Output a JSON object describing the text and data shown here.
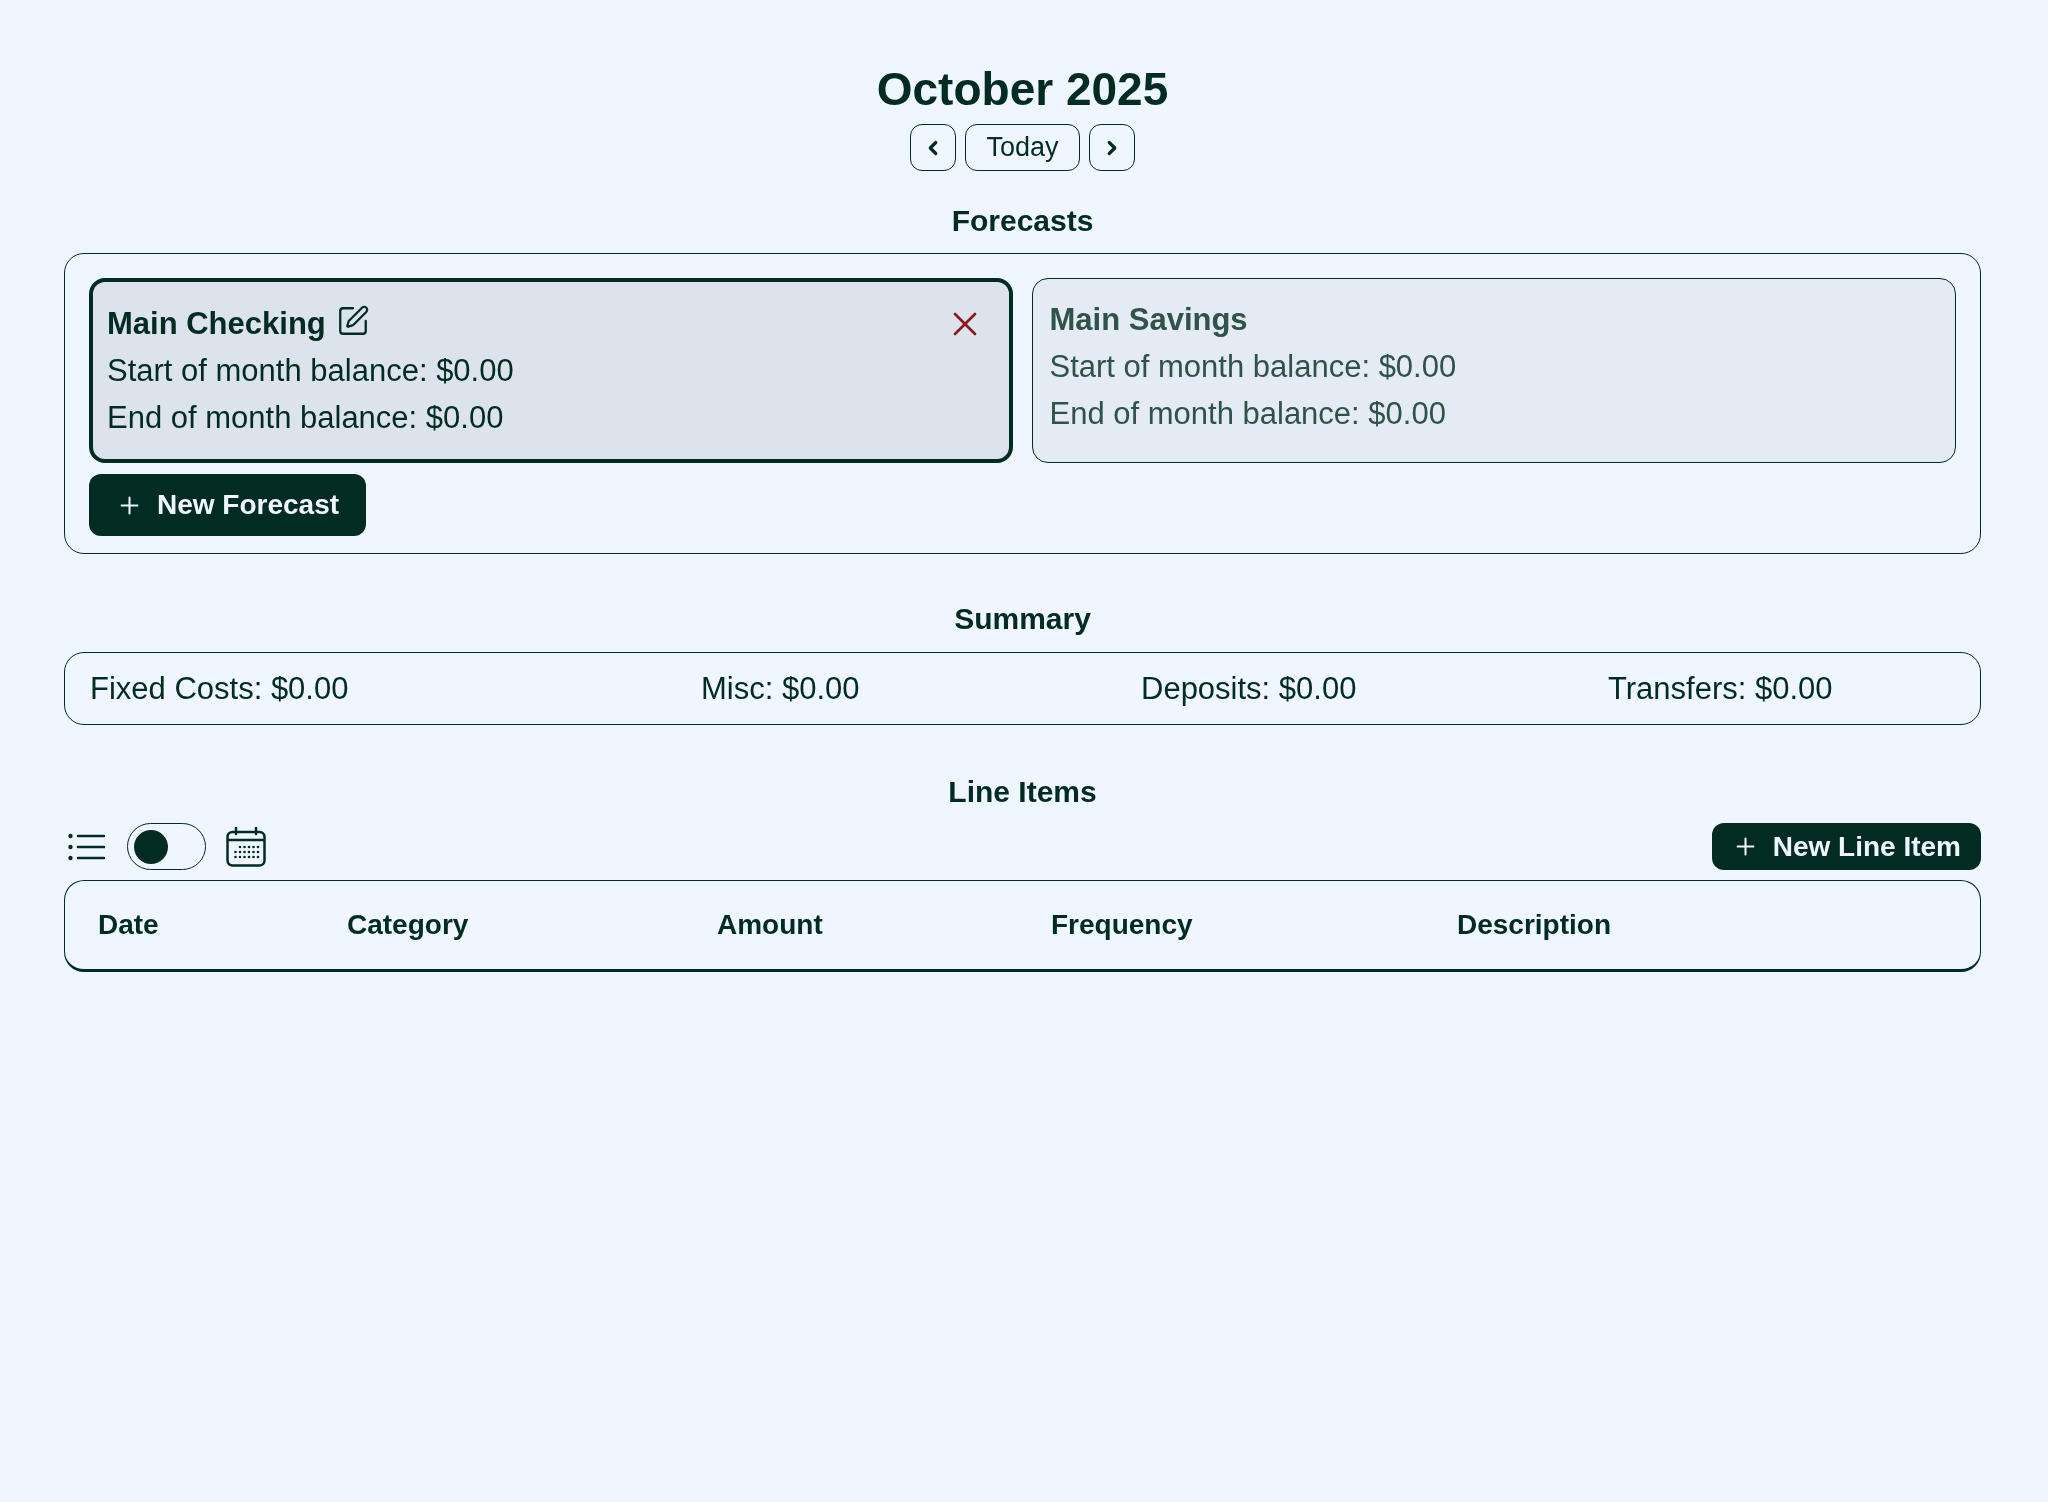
{
  "header": {
    "title": "October 2025",
    "today_button": "Today"
  },
  "forecasts": {
    "heading": "Forecasts",
    "cards": [
      {
        "name": "Main Checking",
        "selected": true,
        "start_balance": "Start of month balance: $0.00",
        "end_balance": "End of month balance: $0.00"
      },
      {
        "name": "Main Savings",
        "selected": false,
        "start_balance": "Start of month balance: $0.00",
        "end_balance": "End of month balance: $0.00"
      }
    ],
    "new_button": "New Forecast"
  },
  "summary": {
    "heading": "Summary",
    "items": [
      "Fixed Costs: $0.00",
      "Misc: $0.00",
      "Deposits: $0.00",
      "Transfers: $0.00"
    ]
  },
  "line_items": {
    "heading": "Line Items",
    "view_toggle": {
      "on": false
    },
    "new_button": "New Line Item",
    "table": {
      "columns": [
        "Date",
        "Category",
        "Amount",
        "Frequency",
        "Description"
      ]
    }
  }
}
